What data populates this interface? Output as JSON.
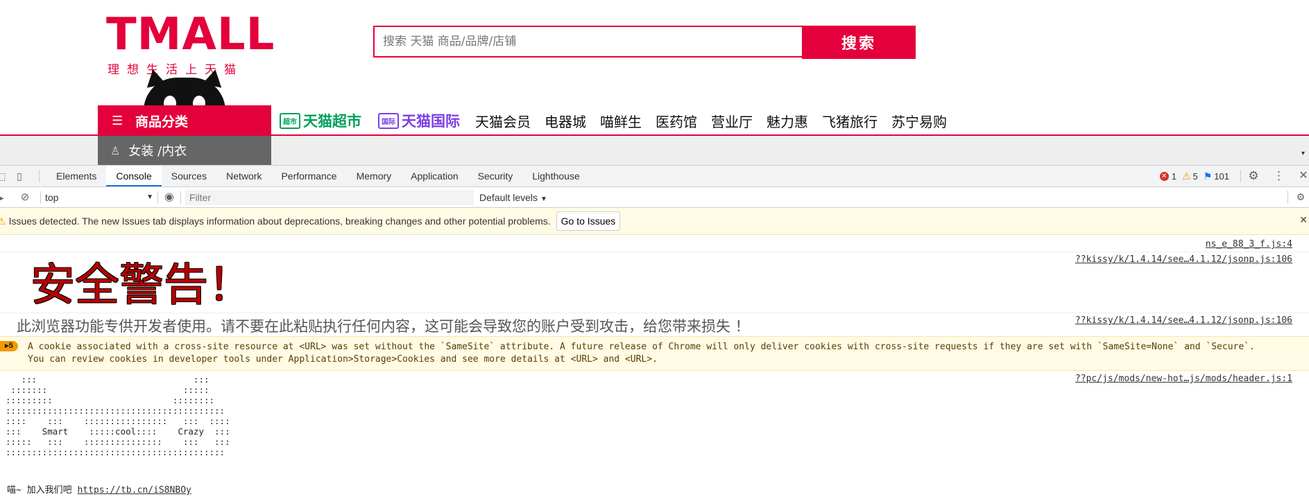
{
  "site": {
    "logo_text": "TMALL",
    "logo_tagline": "理想生活上天猫",
    "search": {
      "placeholder": "搜索 天猫 商品/品牌/店铺",
      "button": "搜索"
    },
    "category_header": "商品分类",
    "category_first_item": "女装 /内衣",
    "nav": {
      "supermarket_badge": "超市",
      "supermarket": "天猫超市",
      "global_badge": "国际",
      "global": "天猫国际",
      "items": [
        "天猫会员",
        "电器城",
        "喵鲜生",
        "医药馆",
        "营业厅",
        "魅力惠",
        "飞猪旅行",
        "苏宁易购"
      ]
    },
    "brand_color": "#e4003a"
  },
  "devtools": {
    "tabs": [
      "Elements",
      "Console",
      "Sources",
      "Network",
      "Performance",
      "Memory",
      "Application",
      "Security",
      "Lighthouse"
    ],
    "active_tab": "Console",
    "counts": {
      "errors": "1",
      "warnings": "5",
      "info": "101"
    },
    "toolbar": {
      "context": "top",
      "filter_placeholder": "Filter",
      "levels": "Default levels"
    },
    "issues": {
      "text": "Issues detected. The new Issues tab displays information about deprecations, breaking changes and other potential problems.",
      "button": "Go to Issues"
    },
    "console": {
      "messages": [
        {
          "source": "ns_e_88_3_f.js:4"
        },
        {
          "source": "??kissy/k/1.4.14/see…4.1.12/jsonp.js:106",
          "text": "安全警告！"
        },
        {
          "source": "??kissy/k/1.4.14/see…4.1.12/jsonp.js:106",
          "text": "此浏览器功能专供开发者使用。请不要在此粘贴执行任何内容，这可能会导致您的账户受到攻击，给您带来损失 ！"
        },
        {
          "badge": "5",
          "text": "A cookie associated with a cross-site resource at <URL> was set without the `SameSite` attribute. A future release of Chrome will only deliver cookies with cross-site requests if they are set with `SameSite=None` and `Secure`. You can review cookies in developer tools under Application>Storage>Cookies and see more details at <URL> and <URL>."
        },
        {
          "source": "??pc/js/mods/new-hot…js/mods/header.js:1"
        }
      ],
      "ascii_art": "   :::                              :::\n :::::::                          :::::\n:::::::::                       ::::::::\n::::::::::::::::::::::::::::::::::::::::::\n::::    :::    ::::::::::::::::   :::  ::::\n:::    Smart    :::::cool::::    Crazy  :::\n:::::   :::    :::::::::::::::    :::   :::\n::::::::::::::::::::::::::::::::::::::::::",
      "join_text": "喵~ 加入我们吧",
      "join_link": "https://tb.cn/iS8NBOy"
    }
  }
}
